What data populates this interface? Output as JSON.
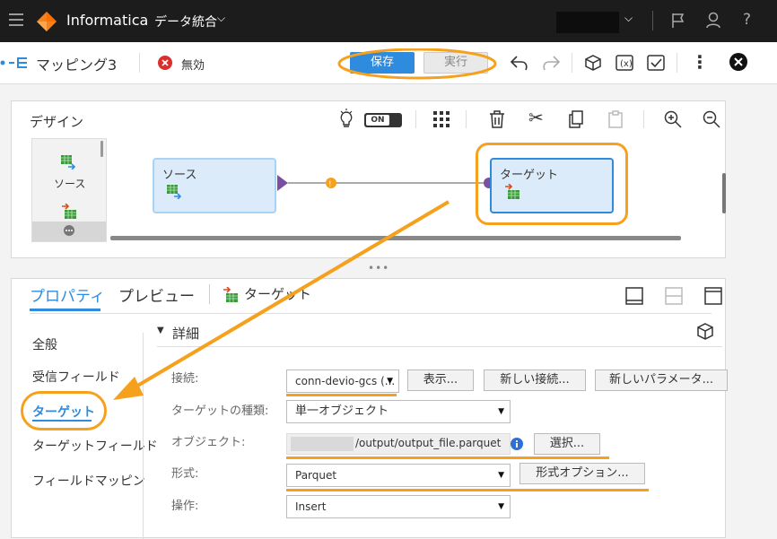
{
  "header": {
    "product": "Informatica",
    "service": "データ統合"
  },
  "toolbar": {
    "title": "マッピング3",
    "status": "無効",
    "save": "保存",
    "run": "実行"
  },
  "design": {
    "title": "デザイン",
    "toggle": "ON",
    "palette": [
      "ソース"
    ],
    "source_node": "ソース",
    "target_node": "ターゲット"
  },
  "props": {
    "tabs": [
      "プロパティ",
      "プレビュー",
      "ターゲット"
    ],
    "sidebar": [
      "全般",
      "受信フィールド",
      "ターゲット",
      "ターゲットフィールド",
      "フィールドマッピング"
    ],
    "section": "詳細",
    "labels": {
      "connection": "接続:",
      "target_type": "ターゲットの種類:",
      "object": "オブジェクト:",
      "format": "形式:",
      "operation": "操作:"
    },
    "values": {
      "connection": "conn-devio-gcs (...",
      "target_type": "単一オブジェクト",
      "object": "/output/output_file.parquet",
      "format": "Parquet",
      "operation": "Insert"
    },
    "buttons": {
      "show": "表示...",
      "new_conn": "新しい接続...",
      "new_param": "新しいパラメータ...",
      "select": "選択...",
      "format_opt": "形式オプション..."
    }
  },
  "colors": {
    "accent": "#f5a11e",
    "primary": "#2e8bde"
  }
}
